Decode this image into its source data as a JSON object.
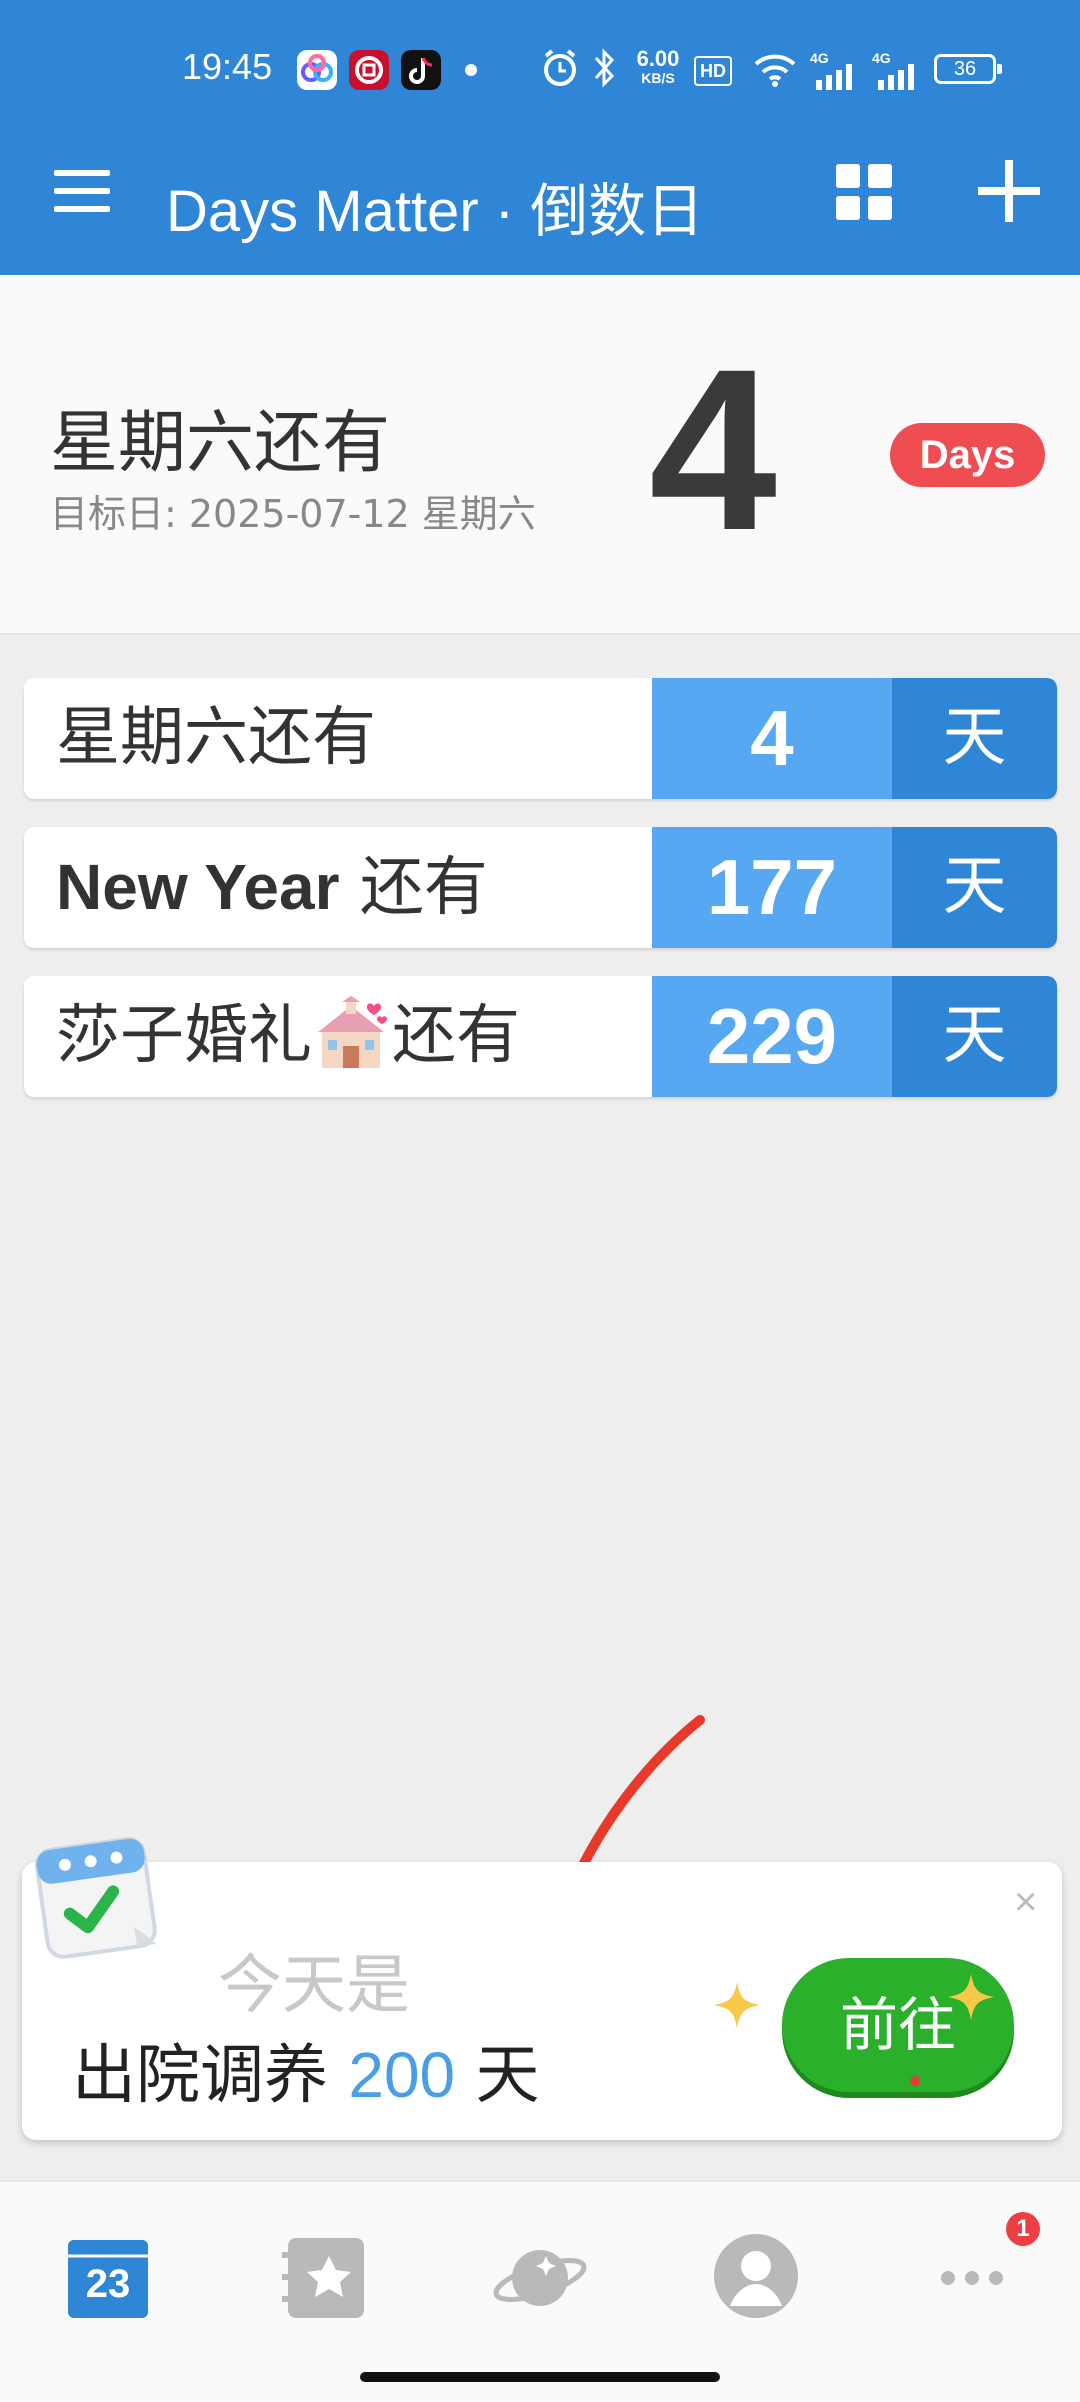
{
  "status_bar": {
    "time": "19:45",
    "net_speed_value": "6.00",
    "net_speed_unit": "KB/S",
    "hd_label": "HD",
    "sim1_label": "4G",
    "sim2_label": "4G",
    "battery": "36"
  },
  "app_bar": {
    "title": "Days Matter · 倒数日"
  },
  "hero": {
    "title": "星期六还有",
    "subtitle": "目标日: 2025-07-12 星期六",
    "count": "4",
    "badge": "Days"
  },
  "events": [
    {
      "label": "星期六还有",
      "count": "4",
      "unit": "天"
    },
    {
      "label_bold": "New Year",
      "label_rest": " 还有",
      "count": "177",
      "unit": "天"
    },
    {
      "label_pre": "莎子婚礼",
      "label_post": "还有",
      "count": "229",
      "unit": "天"
    }
  ],
  "popup": {
    "hint": "今天是",
    "text_pre": "出院调养 ",
    "count": "200",
    "text_post": " 天",
    "button": "前往",
    "close": "×"
  },
  "bottom_nav": {
    "calendar_day": "23",
    "more_badge": "1"
  },
  "colors": {
    "primary": "#2f86d6",
    "count_bg": "#57a8f2",
    "badge_red": "#ef4d52",
    "go_green": "#2ab02a",
    "popup_num": "#4a9ee6"
  }
}
